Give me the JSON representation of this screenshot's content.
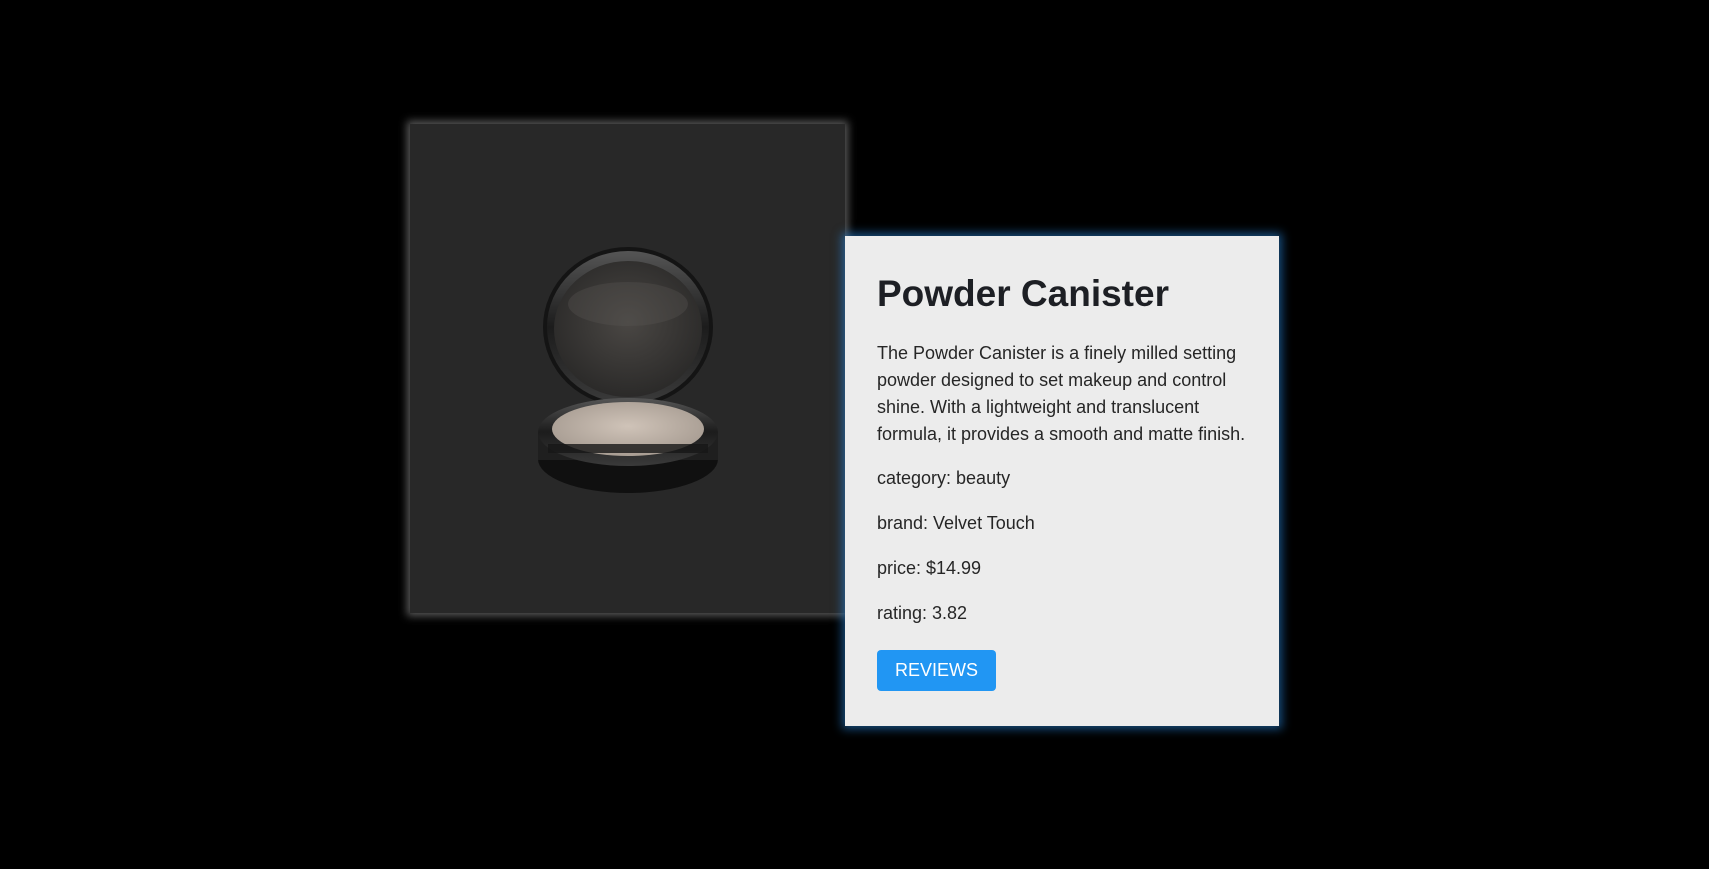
{
  "product": {
    "title": "Powder Canister",
    "description": "The Powder Canister is a finely milled setting powder designed to set makeup and control shine. With a lightweight and translucent formula, it provides a smooth and matte finish.",
    "category_line": "category: beauty",
    "brand_line": "brand: Velvet Touch",
    "price_line": "price: $14.99",
    "rating_line": "rating: 3.82",
    "reviews_label": "REVIEWS",
    "image_icon": "powder-compact-image"
  },
  "colors": {
    "background": "#000000",
    "image_panel": "#282828",
    "card": "#ececec",
    "accent": "#2196f3"
  }
}
